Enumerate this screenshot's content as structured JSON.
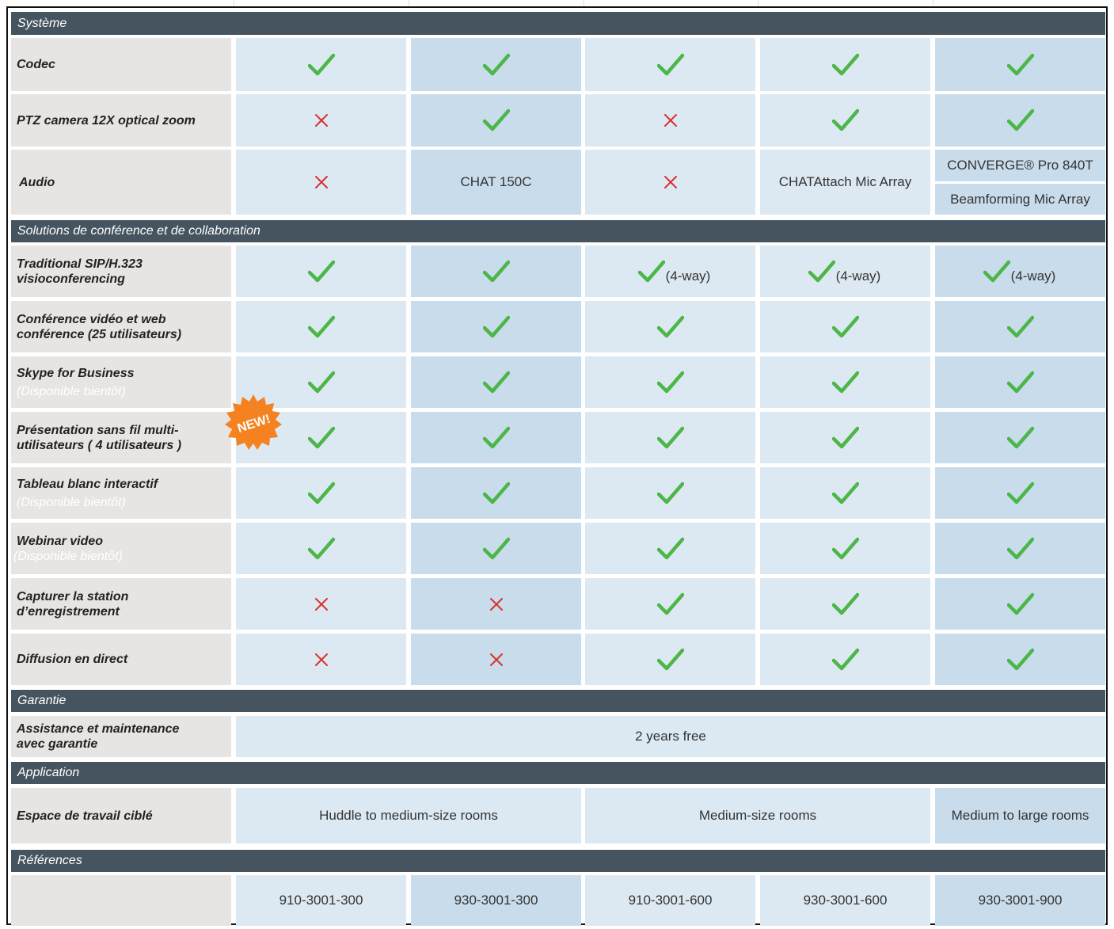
{
  "sections": {
    "systeme": "Système",
    "solutions": "Solutions de conférence et de collaboration",
    "garantie": "Garantie",
    "application": "Application",
    "references": "Références"
  },
  "rows": {
    "codec": "Codec",
    "ptz": "PTZ camera 12X optical zoom",
    "audio": "Audio",
    "sip_1": "Traditional SIP/H.323",
    "sip_2": "visioconferencing",
    "conf_1": "Conférence vidéo et web",
    "conf_2": "conférence (25 utilisateurs)",
    "skype": "Skype for Business",
    "soon": "(Disponible bientôt)",
    "pres_1": "Présentation sans fil multi-",
    "pres_2": "utilisateurs ( 4 utilisateurs )",
    "tableau": "Tableau blanc interactif",
    "webinar": "Webinar video",
    "capture_1": "Capturer la station",
    "capture_2": "d’enregistrement",
    "diffusion": "Diffusion en direct",
    "assist_1": "Assistance et maintenance",
    "assist_2": "avec garantie",
    "espace": "Espace de travail ciblé"
  },
  "values": {
    "audio_c2": "CHAT 150C",
    "audio_c4": "CHATAttach Mic Array",
    "audio_c5_top": "CONVERGE® Pro 840T",
    "audio_c5_bot": "Beamforming Mic Array",
    "four_way": "(4-way)",
    "warranty": "2 years free",
    "app_a": "Huddle to medium-size rooms",
    "app_b": "Medium-size rooms",
    "app_c": "Medium to large rooms",
    "ref_1": "910-3001-300",
    "ref_2": "930-3001-300",
    "ref_3": "910-3001-600",
    "ref_4": "930-3001-600",
    "ref_5": "930-3001-900"
  },
  "badge": "NEW!",
  "colors": {
    "header": "#45545f",
    "check": "#4cb648",
    "cross": "#d9322f",
    "badge": "#f58220"
  }
}
